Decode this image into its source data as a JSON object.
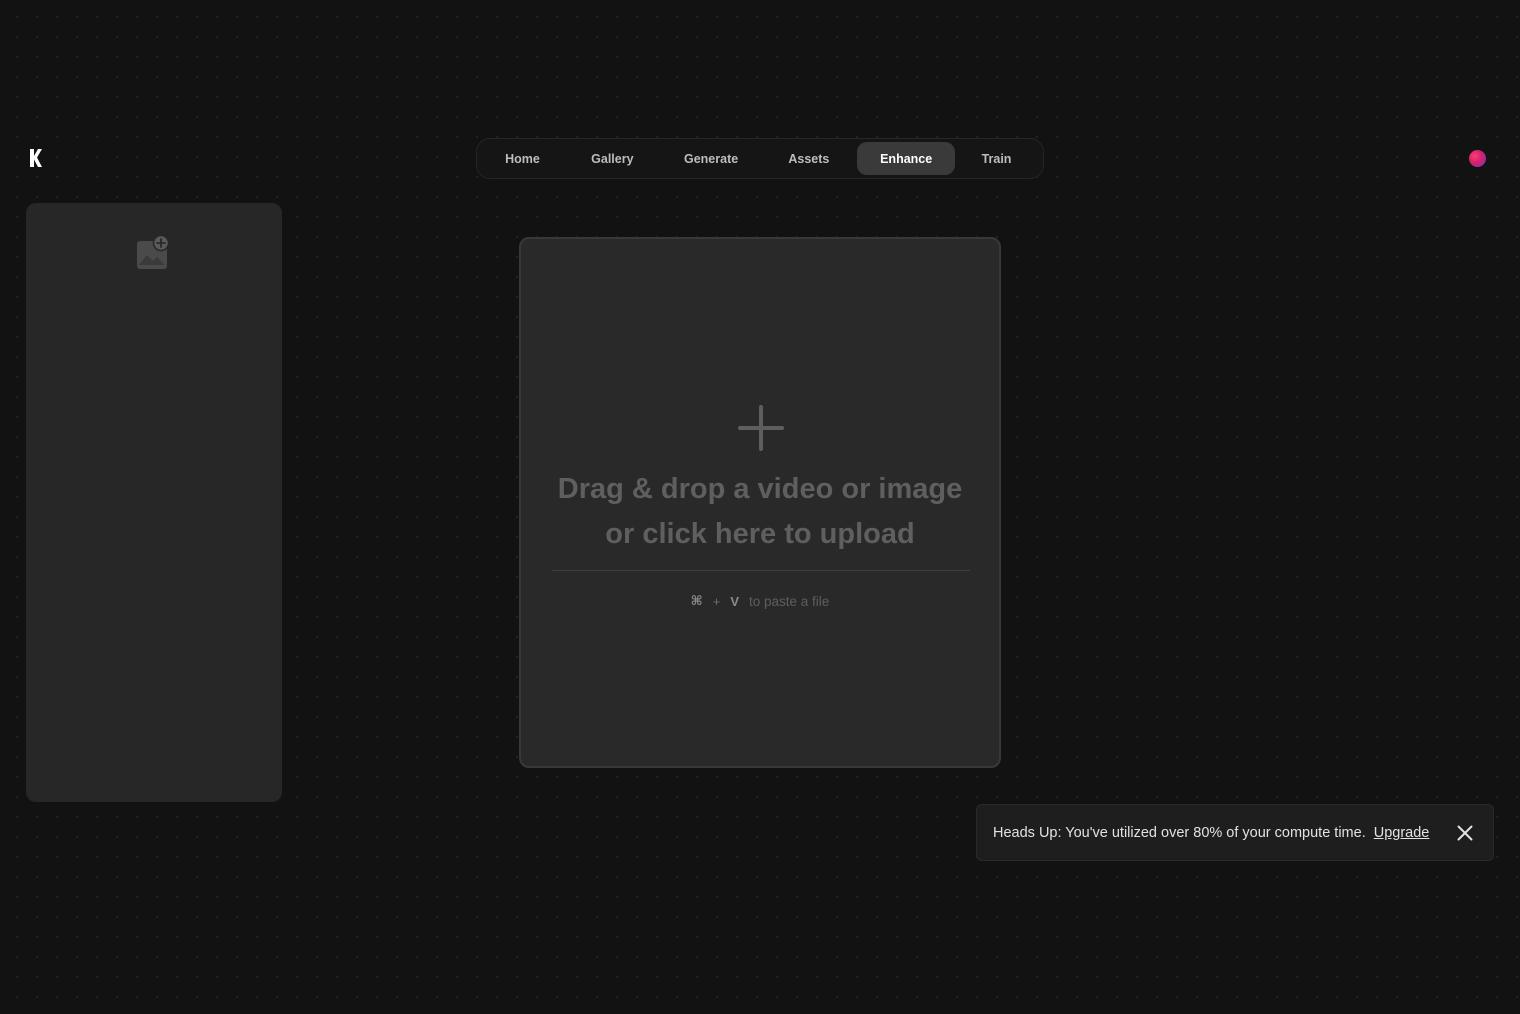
{
  "logo": {
    "icon": "krea-logo-icon"
  },
  "nav": {
    "items": [
      {
        "label": "Home",
        "active": false
      },
      {
        "label": "Gallery",
        "active": false
      },
      {
        "label": "Generate",
        "active": false
      },
      {
        "label": "Assets",
        "active": false
      },
      {
        "label": "Enhance",
        "active": true
      },
      {
        "label": "Train",
        "active": false
      }
    ]
  },
  "avatar": {
    "icon": "user-avatar",
    "colors": [
      "#ff3a78",
      "#7a2fd0"
    ]
  },
  "side_panel": {
    "icon": "add-image-icon"
  },
  "dropzone": {
    "icon": "plus-icon",
    "title_line1": "Drag & drop a video or image",
    "title_line2": "or click here to upload",
    "shortcut_key1": "⌘",
    "shortcut_plus": "+",
    "shortcut_key2": "V",
    "shortcut_text": "to paste a file"
  },
  "toast": {
    "message": "Heads Up: You've utilized over 80% of your compute time.",
    "link": "Upgrade",
    "close_icon": "close-icon"
  },
  "colors": {
    "background": "#121212",
    "panel": "#272727",
    "active_tab": "#3a3a3a"
  }
}
